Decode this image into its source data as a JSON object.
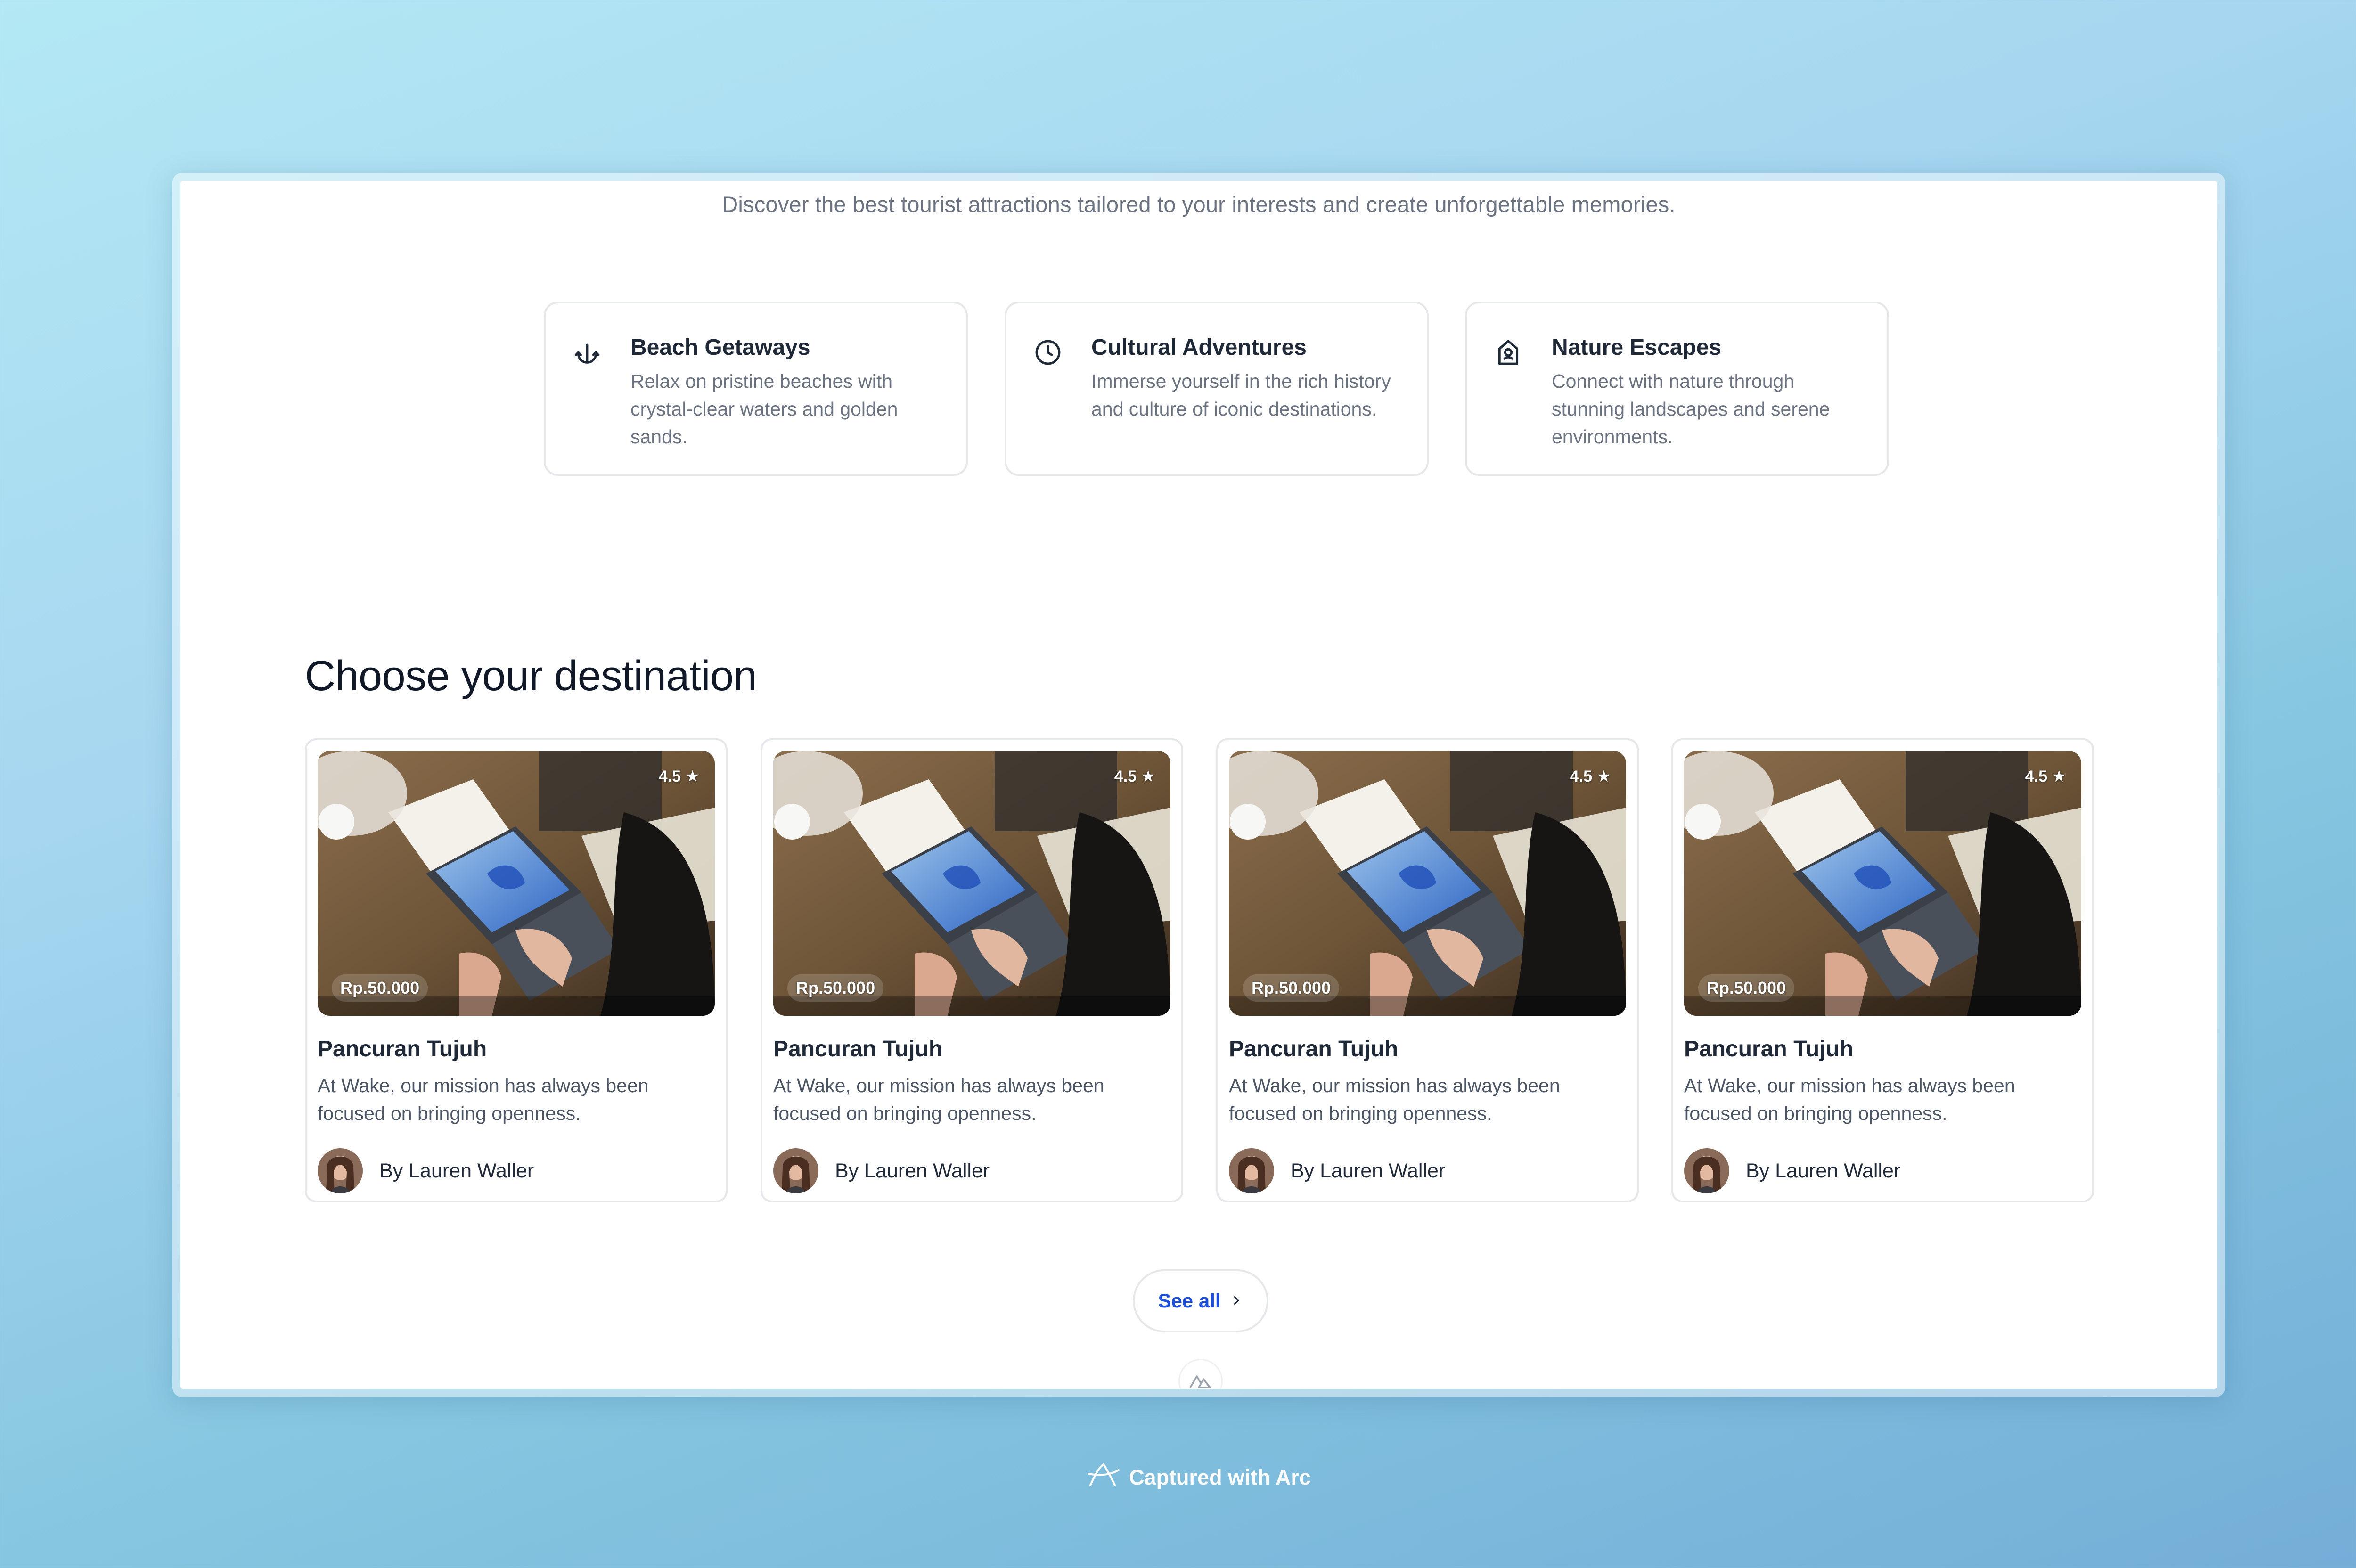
{
  "intro_text": "Discover the best tourist attractions tailored to your interests and create unforgettable memories.",
  "features": [
    {
      "icon": "anchor-icon",
      "title": "Beach Getaways",
      "description": "Relax on pristine beaches with crystal-clear waters and golden sands."
    },
    {
      "icon": "clock-icon",
      "title": "Cultural Adventures",
      "description": "Immerse yourself in the rich history and culture of iconic destinations."
    },
    {
      "icon": "map-pin-icon",
      "title": "Nature Escapes",
      "description": "Connect with nature through stunning landscapes and serene environments."
    }
  ],
  "section_title": "Choose your destination",
  "cards": [
    {
      "rating": "4.5",
      "price": "Rp.50.000",
      "title": "Pancuran Tujuh",
      "description": "At Wake, our mission has always been focused on bringing openness.",
      "author": "By Lauren Waller"
    },
    {
      "rating": "4.5",
      "price": "Rp.50.000",
      "title": "Pancuran Tujuh",
      "description": "At Wake, our mission has always been focused on bringing openness.",
      "author": "By Lauren Waller"
    },
    {
      "rating": "4.5",
      "price": "Rp.50.000",
      "title": "Pancuran Tujuh",
      "description": "At Wake, our mission has always been focused on bringing openness.",
      "author": "By Lauren Waller"
    },
    {
      "rating": "4.5",
      "price": "Rp.50.000",
      "title": "Pancuran Tujuh",
      "description": "At Wake, our mission has always been focused on bringing openness.",
      "author": "By Lauren Waller"
    }
  ],
  "see_all_label": "See all",
  "footer_caption": "Captured with Arc",
  "colors": {
    "link": "#1d4ed8",
    "heading": "#111827",
    "muted": "#6b7280"
  }
}
